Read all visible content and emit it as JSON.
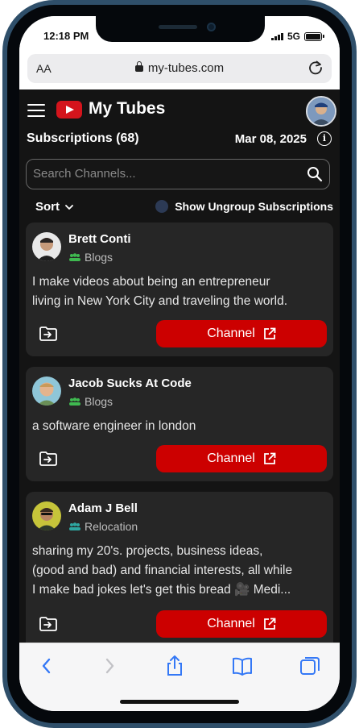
{
  "status_bar": {
    "time": "12:18 PM",
    "network": "5G"
  },
  "browser": {
    "text_size": "AA",
    "url": "my-tubes.com"
  },
  "header": {
    "app_title": "My Tubes"
  },
  "summary": {
    "subscriptions_label": "Subscriptions (68)",
    "date": "Mar 08, 2025",
    "info_icon": "info-icon"
  },
  "search": {
    "placeholder": "Search Channels..."
  },
  "controls": {
    "sort_label": "Sort",
    "toggle_label": "Show Ungroup Subscriptions"
  },
  "channels": [
    {
      "name": "Brett Conti",
      "group": "Blogs",
      "description_line1": "I make videos about being an entrepreneur",
      "description_line2": "living in New York City and traveling the world.",
      "button_label": "Channel"
    },
    {
      "name": "Jacob Sucks At Code",
      "group": "Blogs",
      "description_line1": "a software engineer in london",
      "button_label": "Channel"
    },
    {
      "name": "Adam J Bell",
      "group": "Relocation",
      "description_line1": "sharing my 20's. projects, business ideas,",
      "description_line2": "(good and bad) and financial interests, all while",
      "description_line3": "I make bad jokes let's get this bread 🎥 Medi...",
      "button_label": "Channel"
    }
  ],
  "colors": {
    "accent": "#cc0000",
    "background": "#141414",
    "card": "#262626",
    "group_icon_blog": "#3fb950",
    "group_icon_relocation": "#2ea6a0"
  },
  "toolbar_icons": [
    "back-icon",
    "forward-icon",
    "share-icon",
    "bookmarks-icon",
    "tabs-icon"
  ]
}
